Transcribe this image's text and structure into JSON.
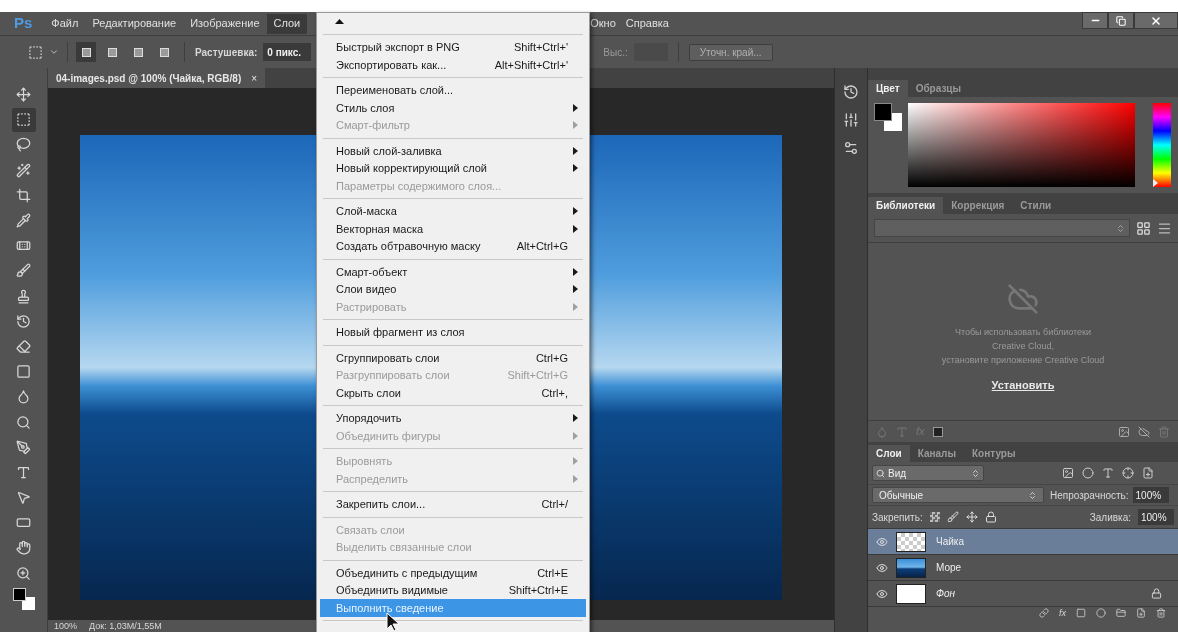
{
  "app_logo": "Ps",
  "menu_bar": [
    {
      "label": "Файл",
      "selected": false
    },
    {
      "label": "Редактирование",
      "selected": false
    },
    {
      "label": "Изображение",
      "selected": false
    },
    {
      "label": "Слои",
      "selected": true
    }
  ],
  "menu_bar_right": [
    {
      "label": "Окно",
      "selected": false
    },
    {
      "label": "Справка",
      "selected": false
    }
  ],
  "options_bar": {
    "modes": [
      {
        "selected": true
      },
      {
        "selected": false
      },
      {
        "selected": false
      },
      {
        "selected": false
      }
    ],
    "feather_label": "Растушевка:",
    "feather_value": "0 пикс.",
    "height_label": "Выс.:",
    "refine_button": "Уточн. край..."
  },
  "document_tab": {
    "title": "04-images.psd @ 100% (Чайка, RGB/8)",
    "close": "×"
  },
  "tools": [
    {
      "kind": "move",
      "selected": false
    },
    {
      "kind": "marquee",
      "selected": true
    },
    {
      "kind": "lasso",
      "selected": false
    },
    {
      "kind": "wand",
      "selected": false
    },
    {
      "kind": "crop",
      "selected": false
    },
    {
      "kind": "pipette",
      "selected": false
    },
    {
      "kind": "bandage",
      "selected": false
    },
    {
      "kind": "brush",
      "selected": false
    },
    {
      "kind": "stamp",
      "selected": false
    },
    {
      "kind": "history",
      "selected": false
    },
    {
      "kind": "eraser",
      "selected": false
    },
    {
      "kind": "gradient",
      "selected": false
    },
    {
      "kind": "droplet",
      "selected": false
    },
    {
      "kind": "dodge",
      "selected": false
    },
    {
      "kind": "pen",
      "selected": false
    },
    {
      "kind": "type",
      "selected": false
    },
    {
      "kind": "pointer",
      "selected": false
    },
    {
      "kind": "rectangle",
      "selected": false
    },
    {
      "kind": "hand",
      "selected": false
    },
    {
      "kind": "zoom",
      "selected": false
    }
  ],
  "status_bar": {
    "zoom": "100%",
    "doc_info": "Док: 1,03M/1,55M"
  },
  "layer_menu": [
    {
      "kind": "separator"
    },
    {
      "kind": "item",
      "label": "Быстрый экспорт в PNG",
      "shortcut": "Shift+Ctrl+'",
      "submenu": false,
      "disabled": false,
      "selected": false
    },
    {
      "kind": "item",
      "label": "Экспортировать как...",
      "shortcut": "Alt+Shift+Ctrl+'",
      "submenu": false,
      "disabled": false,
      "selected": false
    },
    {
      "kind": "separator"
    },
    {
      "kind": "item",
      "label": "Переименовать слой...",
      "submenu": false,
      "disabled": false,
      "selected": false
    },
    {
      "kind": "item",
      "label": "Стиль слоя",
      "submenu": true,
      "disabled": false,
      "selected": false
    },
    {
      "kind": "item",
      "label": "Смарт-фильтр",
      "submenu": true,
      "disabled": true,
      "selected": false
    },
    {
      "kind": "separator"
    },
    {
      "kind": "item",
      "label": "Новый слой-заливка",
      "submenu": true,
      "disabled": false,
      "selected": false
    },
    {
      "kind": "item",
      "label": "Новый корректирующий слой",
      "submenu": true,
      "disabled": false,
      "selected": false
    },
    {
      "kind": "item",
      "label": "Параметры содержимого слоя...",
      "submenu": false,
      "disabled": true,
      "selected": false
    },
    {
      "kind": "separator"
    },
    {
      "kind": "item",
      "label": "Слой-маска",
      "submenu": true,
      "disabled": false,
      "selected": false
    },
    {
      "kind": "item",
      "label": "Векторная маска",
      "submenu": true,
      "disabled": false,
      "selected": false
    },
    {
      "kind": "item",
      "label": "Создать обтравочную маску",
      "shortcut": "Alt+Ctrl+G",
      "submenu": false,
      "disabled": false,
      "selected": false
    },
    {
      "kind": "separator"
    },
    {
      "kind": "item",
      "label": "Смарт-объект",
      "submenu": true,
      "disabled": false,
      "selected": false
    },
    {
      "kind": "item",
      "label": "Слои видео",
      "submenu": true,
      "disabled": false,
      "selected": false
    },
    {
      "kind": "item",
      "label": "Растрировать",
      "submenu": true,
      "disabled": true,
      "selected": false
    },
    {
      "kind": "separator"
    },
    {
      "kind": "item",
      "label": "Новый фрагмент из слоя",
      "submenu": false,
      "disabled": false,
      "selected": false
    },
    {
      "kind": "separator"
    },
    {
      "kind": "item",
      "label": "Сгруппировать слои",
      "shortcut": "Ctrl+G",
      "submenu": false,
      "disabled": false,
      "selected": false
    },
    {
      "kind": "item",
      "label": "Разгруппировать слои",
      "shortcut": "Shift+Ctrl+G",
      "submenu": false,
      "disabled": true,
      "selected": false
    },
    {
      "kind": "item",
      "label": "Скрыть слои",
      "shortcut": "Ctrl+,",
      "submenu": false,
      "disabled": false,
      "selected": false
    },
    {
      "kind": "separator"
    },
    {
      "kind": "item",
      "label": "Упорядочить",
      "submenu": true,
      "disabled": false,
      "selected": false
    },
    {
      "kind": "item",
      "label": "Объединить фигуры",
      "submenu": true,
      "disabled": true,
      "selected": false
    },
    {
      "kind": "separator"
    },
    {
      "kind": "item",
      "label": "Выровнять",
      "submenu": true,
      "disabled": true,
      "selected": false
    },
    {
      "kind": "item",
      "label": "Распределить",
      "submenu": true,
      "disabled": true,
      "selected": false
    },
    {
      "kind": "separator"
    },
    {
      "kind": "item",
      "label": "Закрепить слои...",
      "shortcut": "Ctrl+/",
      "submenu": false,
      "disabled": false,
      "selected": false
    },
    {
      "kind": "separator"
    },
    {
      "kind": "item",
      "label": "Связать слои",
      "submenu": false,
      "disabled": true,
      "selected": false
    },
    {
      "kind": "item",
      "label": "Выделить связанные слои",
      "submenu": false,
      "disabled": true,
      "selected": false
    },
    {
      "kind": "separator"
    },
    {
      "kind": "item",
      "label": "Объединить с предыдущим",
      "shortcut": "Ctrl+E",
      "submenu": false,
      "disabled": false,
      "selected": false
    },
    {
      "kind": "item",
      "label": "Объединить видимые",
      "shortcut": "Shift+Ctrl+E",
      "submenu": false,
      "disabled": false,
      "selected": false
    },
    {
      "kind": "item",
      "label": "Выполнить сведение",
      "submenu": false,
      "disabled": false,
      "selected": true
    },
    {
      "kind": "separator"
    }
  ],
  "color_panel": {
    "tabs": [
      {
        "label": "Цвет",
        "selected": true
      },
      {
        "label": "Образцы",
        "selected": false
      }
    ],
    "hue": {
      "level": 0
    }
  },
  "libraries_panel": {
    "tabs": [
      {
        "label": "Библиотеки",
        "selected": true
      },
      {
        "label": "Коррекция",
        "selected": false
      },
      {
        "label": "Стили",
        "selected": false
      }
    ],
    "message": "Чтобы использовать библиотеки\nCreative Cloud,\nустановите приложение Creative Cloud",
    "install_link": "Установить",
    "toolbar_fx": "fx"
  },
  "layers_panel": {
    "tabs": [
      {
        "label": "Слои",
        "selected": true
      },
      {
        "label": "Каналы",
        "selected": false
      },
      {
        "label": "Контуры",
        "selected": false
      }
    ],
    "filter": "Вид",
    "blend_mode": "Обычные",
    "opacity_label": "Непрозрачность:",
    "opacity": "100%",
    "lock_label": "Закрепить:",
    "fill_label": "Заливка:",
    "fill": "100%",
    "toolbar_fx": "fx",
    "layers": [
      {
        "name": "Чайка",
        "kind": "transparent",
        "selected": true,
        "visible": true,
        "locked": false,
        "background": false
      },
      {
        "name": "Море",
        "kind": "sea",
        "selected": false,
        "visible": true,
        "locked": false,
        "background": false
      },
      {
        "name": "Фон",
        "kind": "white",
        "selected": false,
        "visible": true,
        "locked": true,
        "background": true
      }
    ]
  }
}
